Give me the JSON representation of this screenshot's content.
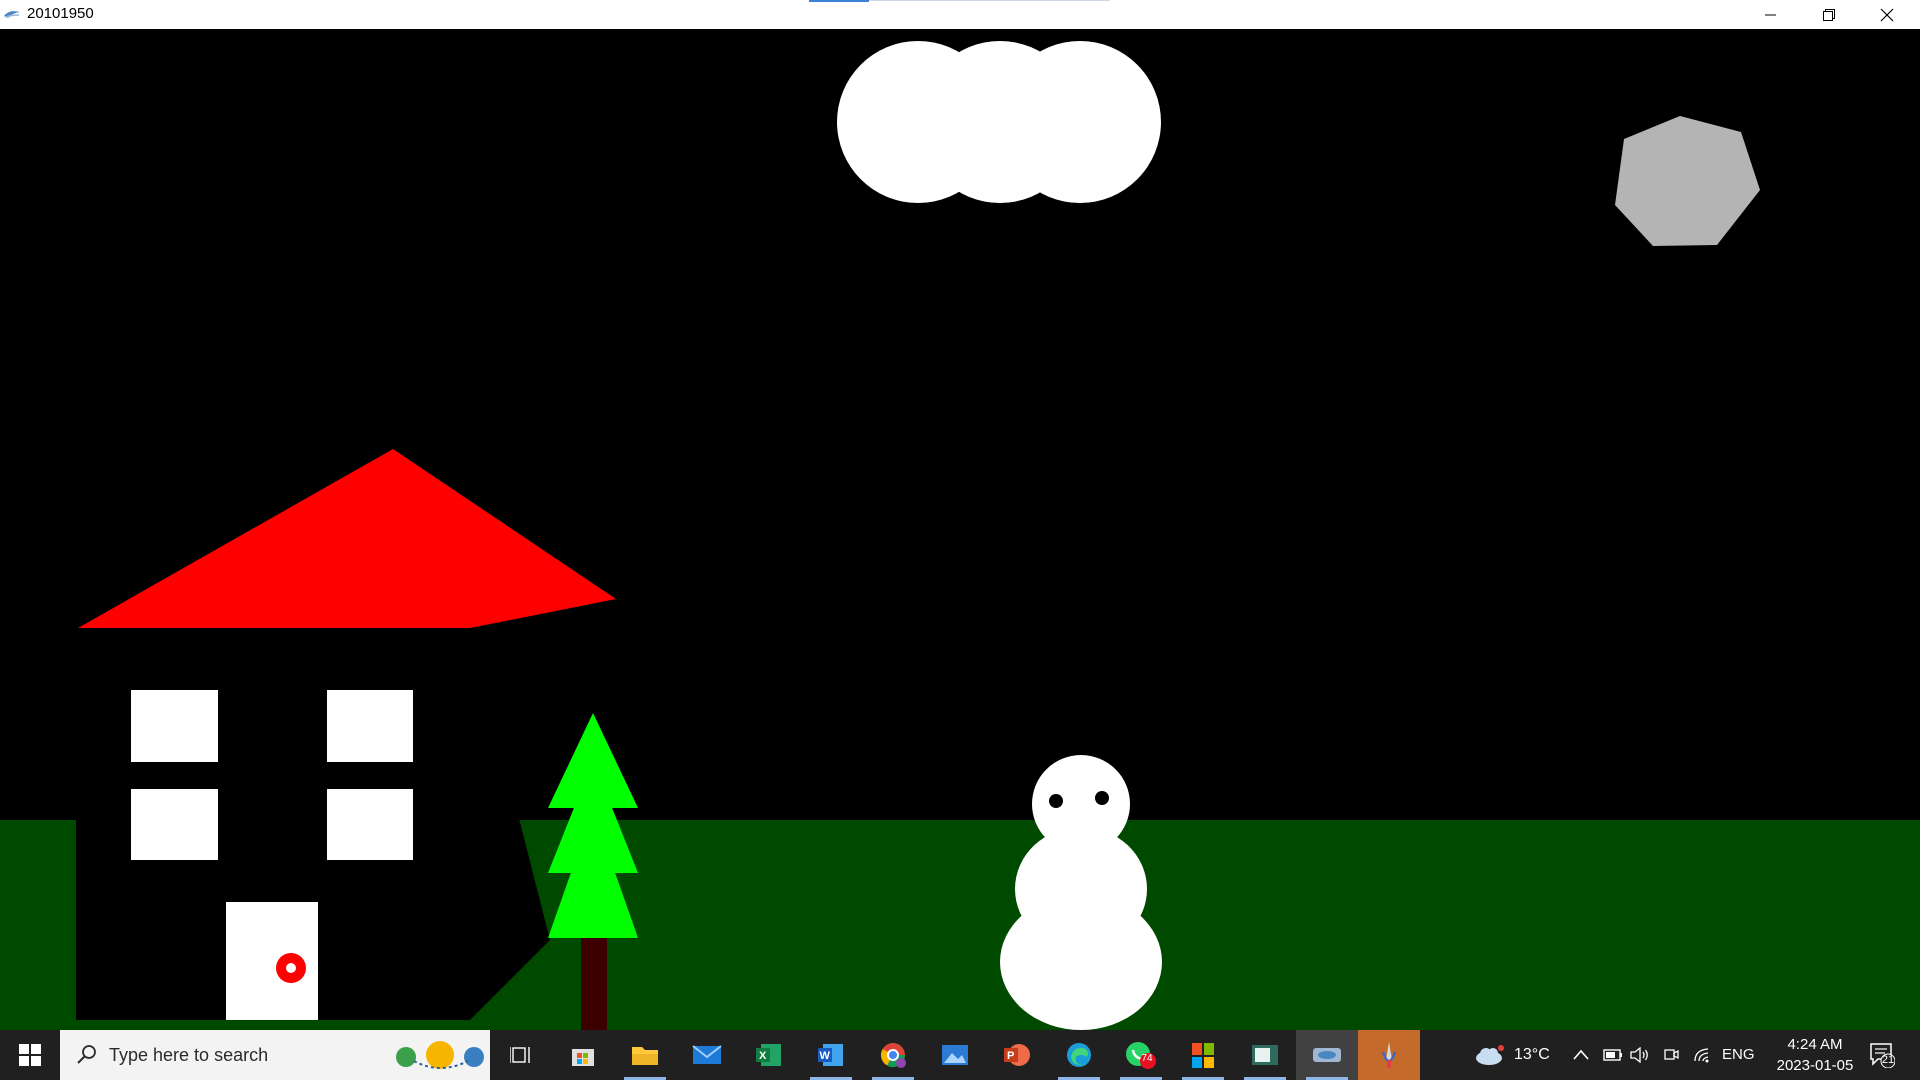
{
  "window": {
    "title": "20101950"
  },
  "colors": {
    "sky": "#000000",
    "grass": "#004a00",
    "roof": "#ff0000",
    "house_body": "#000000",
    "window": "#ffffff",
    "door": "#ffffff",
    "knob": "#ff0000",
    "tree_leaves": "#00ff00",
    "trunk": "#3d0000",
    "snowman": "#ffffff",
    "moon": "#b4b4b4",
    "cloud": "#ffffff"
  },
  "scene": {
    "objects": [
      "cloud",
      "moon",
      "house",
      "tree",
      "snowman",
      "grass"
    ]
  },
  "taskbar": {
    "search_placeholder": "Type here to search",
    "apps": [
      "task-view",
      "microsoft-store",
      "file-explorer",
      "mail",
      "excel",
      "word",
      "chrome",
      "photos",
      "powerpoint",
      "edge",
      "whatsapp",
      "office",
      "notepad",
      "app-running",
      "paint-app"
    ],
    "whatsapp_badge": "74",
    "weather_temp": "13°C",
    "language": "ENG",
    "time": "4:24 AM",
    "date": "2023-01-05",
    "notification_count": "21"
  }
}
